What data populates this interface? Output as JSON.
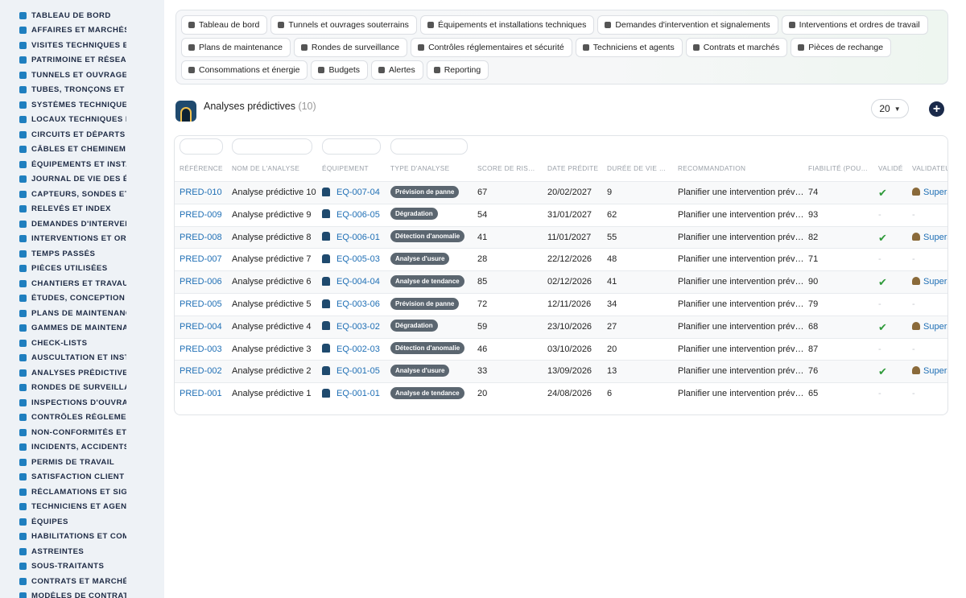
{
  "sidebar": {
    "items": [
      {
        "label": "TABLEAU DE BORD",
        "icon": "dashboard-icon"
      },
      {
        "label": "AFFAIRES ET MARCHÉS",
        "icon": "target-icon"
      },
      {
        "label": "VISITES TECHNIQUES ET",
        "icon": "walk-icon"
      },
      {
        "label": "PATRIMOINE ET RÉSEAUX",
        "icon": "map-pin-icon"
      },
      {
        "label": "TUNNELS ET OUVRAGES",
        "icon": "tunnel-icon"
      },
      {
        "label": "TUBES, TRONÇONS ET ZO",
        "icon": "road-icon"
      },
      {
        "label": "SYSTÈMES TECHNIQUES",
        "icon": "hierarchy-icon"
      },
      {
        "label": "LOCAUX TECHNIQUES ET",
        "icon": "grid-icon"
      },
      {
        "label": "CIRCUITS ET DÉPARTS ÉL",
        "icon": "file-icon"
      },
      {
        "label": "CÂBLES ET CHEMINEMEN",
        "icon": "cable-icon"
      },
      {
        "label": "ÉQUIPEMENTS ET INSTAL",
        "icon": "gears-icon"
      },
      {
        "label": "JOURNAL DE VIE DES ÉQ",
        "icon": "history-icon"
      },
      {
        "label": "CAPTEURS, SONDES ET C",
        "icon": "sensor-icon"
      },
      {
        "label": "RELEVÉS ET INDEX",
        "icon": "clipboard-icon"
      },
      {
        "label": "DEMANDES D'INTERVENT",
        "icon": "request-icon"
      },
      {
        "label": "INTERVENTIONS ET ORDI",
        "icon": "clipboard-check-icon"
      },
      {
        "label": "TEMPS PASSÉS",
        "icon": "clock-icon"
      },
      {
        "label": "PIÈCES UTILISÉES",
        "icon": "parts-icon"
      },
      {
        "label": "CHANTIERS ET TRAVAUX",
        "icon": "hammer-icon"
      },
      {
        "label": "ÉTUDES, CONCEPTION ET",
        "icon": "pencil-icon"
      },
      {
        "label": "PLANS DE MAINTENANCE",
        "icon": "calendar-icon"
      },
      {
        "label": "GAMMES DE MAINTENAN",
        "icon": "list-icon"
      },
      {
        "label": "CHECK-LISTS",
        "icon": "checklist-icon"
      },
      {
        "label": "AUSCULTATION ET INSTR",
        "icon": "thermometer-icon"
      },
      {
        "label": "ANALYSES PRÉDICTIVES",
        "icon": "chart-line-icon"
      },
      {
        "label": "RONDES DE SURVEILLAN",
        "icon": "route-icon"
      },
      {
        "label": "INSPECTIONS D'OUVRAG",
        "icon": "search-icon"
      },
      {
        "label": "CONTRÔLES RÉGLEMENT",
        "icon": "clipboard-icon"
      },
      {
        "label": "NON-CONFORMITÉS ET A",
        "icon": "alert-circle-icon"
      },
      {
        "label": "INCIDENTS, ACCIDENTS E",
        "icon": "warning-icon"
      },
      {
        "label": "PERMIS DE TRAVAIL",
        "icon": "permit-icon"
      },
      {
        "label": "SATISFACTION CLIENT",
        "icon": "smile-icon"
      },
      {
        "label": "RÉCLAMATIONS ET SIGN.",
        "icon": "message-icon"
      },
      {
        "label": "TECHNICIENS ET AGENTS",
        "icon": "helmet-icon"
      },
      {
        "label": "ÉQUIPES",
        "icon": "team-icon"
      },
      {
        "label": "HABILITATIONS ET COMP",
        "icon": "badge-icon"
      },
      {
        "label": "ASTREINTES",
        "icon": "phone-icon"
      },
      {
        "label": "SOUS-TRAITANTS",
        "icon": "handshake-icon"
      },
      {
        "label": "CONTRATS ET MARCHÉS",
        "icon": "contract-icon"
      },
      {
        "label": "MODÈLES DE CONTRATS",
        "icon": "template-icon"
      }
    ]
  },
  "nav": {
    "rows": [
      [
        {
          "label": "Tableau de bord",
          "icon": "dashboard-icon"
        },
        {
          "label": "Tunnels et ouvrages souterrains",
          "icon": "building-icon"
        },
        {
          "label": "Équipements et installations techniques",
          "icon": "gears-icon"
        },
        {
          "label": "Demandes d'intervention et signalements",
          "icon": "question-icon"
        },
        {
          "label": "Interventions et ordres de travail",
          "icon": "clipboard-icon"
        }
      ],
      [
        {
          "label": "Plans de maintenance",
          "icon": "calendar-icon"
        },
        {
          "label": "Rondes de surveillance",
          "icon": "route-icon"
        },
        {
          "label": "Contrôles réglementaires et sécurité",
          "icon": "clipboard-check-icon"
        },
        {
          "label": "Techniciens et agents",
          "icon": "helmet-icon"
        },
        {
          "label": "Contrats et marchés",
          "icon": "contract-icon"
        },
        {
          "label": "Pièces de rechange",
          "icon": "parts-icon"
        }
      ],
      [
        {
          "label": "Consommations et énergie",
          "icon": "bolt-icon"
        },
        {
          "label": "Budgets",
          "icon": "money-icon"
        },
        {
          "label": "Alertes",
          "icon": "bell-icon"
        },
        {
          "label": "Reporting",
          "icon": "pie-icon"
        }
      ]
    ]
  },
  "header": {
    "title": "Analyses prédictives",
    "count": "(10)",
    "page_size": "20",
    "add_icon": "plus-circle-icon"
  },
  "table": {
    "columns": [
      "RÉFÉRENCE",
      "NOM DE L'ANALYSE",
      "ÉQUIPEMENT",
      "TYPE D'ANALYSE",
      "SCORE DE RIS…",
      "DATE PRÉDITE",
      "DURÉE DE VIE …",
      "RECOMMANDATION",
      "FIABILITÉ (POU…",
      "VALIDÉ",
      "VALIDATEUR"
    ],
    "rows": [
      {
        "ref": "PRED-010",
        "name": "Analyse prédictive 10",
        "equip": "EQ-007-04",
        "type": "Prévision de panne",
        "score": "67",
        "date": "20/02/2027",
        "life": "9",
        "reco": "Planifier une intervention prév…",
        "fiab": "74",
        "valide": true,
        "validator": "Supera"
      },
      {
        "ref": "PRED-009",
        "name": "Analyse prédictive 9",
        "equip": "EQ-006-05",
        "type": "Dégradation",
        "score": "54",
        "date": "31/01/2027",
        "life": "62",
        "reco": "Planifier une intervention prév…",
        "fiab": "93",
        "valide": false,
        "validator": "-"
      },
      {
        "ref": "PRED-008",
        "name": "Analyse prédictive 8",
        "equip": "EQ-006-01",
        "type": "Détection d'anomalie",
        "score": "41",
        "date": "11/01/2027",
        "life": "55",
        "reco": "Planifier une intervention prév…",
        "fiab": "82",
        "valide": true,
        "validator": "Supera"
      },
      {
        "ref": "PRED-007",
        "name": "Analyse prédictive 7",
        "equip": "EQ-005-03",
        "type": "Analyse d'usure",
        "score": "28",
        "date": "22/12/2026",
        "life": "48",
        "reco": "Planifier une intervention prév…",
        "fiab": "71",
        "valide": false,
        "validator": "-"
      },
      {
        "ref": "PRED-006",
        "name": "Analyse prédictive 6",
        "equip": "EQ-004-04",
        "type": "Analyse de tendance",
        "score": "85",
        "date": "02/12/2026",
        "life": "41",
        "reco": "Planifier une intervention prév…",
        "fiab": "90",
        "valide": true,
        "validator": "Supera"
      },
      {
        "ref": "PRED-005",
        "name": "Analyse prédictive 5",
        "equip": "EQ-003-06",
        "type": "Prévision de panne",
        "score": "72",
        "date": "12/11/2026",
        "life": "34",
        "reco": "Planifier une intervention prév…",
        "fiab": "79",
        "valide": false,
        "validator": "-"
      },
      {
        "ref": "PRED-004",
        "name": "Analyse prédictive 4",
        "equip": "EQ-003-02",
        "type": "Dégradation",
        "score": "59",
        "date": "23/10/2026",
        "life": "27",
        "reco": "Planifier une intervention prév…",
        "fiab": "68",
        "valide": true,
        "validator": "Supera"
      },
      {
        "ref": "PRED-003",
        "name": "Analyse prédictive 3",
        "equip": "EQ-002-03",
        "type": "Détection d'anomalie",
        "score": "46",
        "date": "03/10/2026",
        "life": "20",
        "reco": "Planifier une intervention prév…",
        "fiab": "87",
        "valide": false,
        "validator": "-"
      },
      {
        "ref": "PRED-002",
        "name": "Analyse prédictive 2",
        "equip": "EQ-001-05",
        "type": "Analyse d'usure",
        "score": "33",
        "date": "13/09/2026",
        "life": "13",
        "reco": "Planifier une intervention prév…",
        "fiab": "76",
        "valide": true,
        "validator": "Supera"
      },
      {
        "ref": "PRED-001",
        "name": "Analyse prédictive 1",
        "equip": "EQ-001-01",
        "type": "Analyse de tendance",
        "score": "20",
        "date": "24/08/2026",
        "life": "6",
        "reco": "Planifier une intervention prév…",
        "fiab": "65",
        "valide": false,
        "validator": "-"
      }
    ]
  },
  "colors": {
    "sidebar_bg": "#eef2f6",
    "accent": "#1f7fbf",
    "link": "#1f6fb5",
    "badge": "#5b6670",
    "check": "#2f9a3a",
    "add_button": "#1a2a4a"
  }
}
